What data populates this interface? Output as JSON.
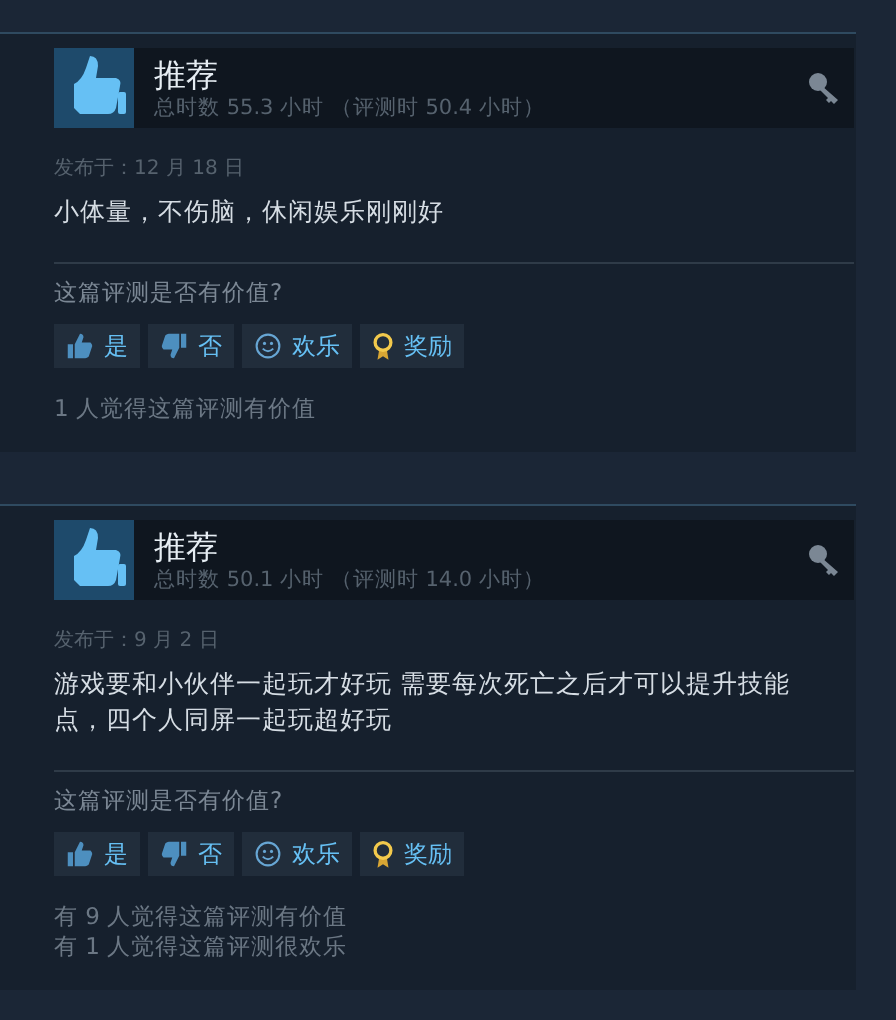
{
  "reviews": [
    {
      "verdict": "推荐",
      "hours": "总时数 55.3 小时 （评测时 50.4 小时）",
      "posted": "发布于：12 月 18 日",
      "body": "小体量，不伤脑，休闲娱乐刚刚好",
      "question": "这篇评测是否有价值?",
      "buttons": [
        {
          "kind": "yes",
          "label": "是"
        },
        {
          "kind": "no",
          "label": "否"
        },
        {
          "kind": "funny",
          "label": "欢乐"
        },
        {
          "kind": "award",
          "label": "奖励"
        }
      ],
      "stats": [
        "1 人觉得这篇评测有价值"
      ]
    },
    {
      "verdict": "推荐",
      "hours": "总时数 50.1 小时 （评测时 14.0 小时）",
      "posted": "发布于：9 月 2 日",
      "body": "游戏要和小伙伴一起玩才好玩 需要每次死亡之后才可以提升技能点，四个人同屏一起玩超好玩",
      "question": "这篇评测是否有价值?",
      "buttons": [
        {
          "kind": "yes",
          "label": "是"
        },
        {
          "kind": "no",
          "label": "否"
        },
        {
          "kind": "funny",
          "label": "欢乐"
        },
        {
          "kind": "award",
          "label": "奖励"
        }
      ],
      "stats": [
        "有 9 人觉得这篇评测有价值",
        "有 1 人觉得这篇评测很欢乐"
      ]
    }
  ]
}
